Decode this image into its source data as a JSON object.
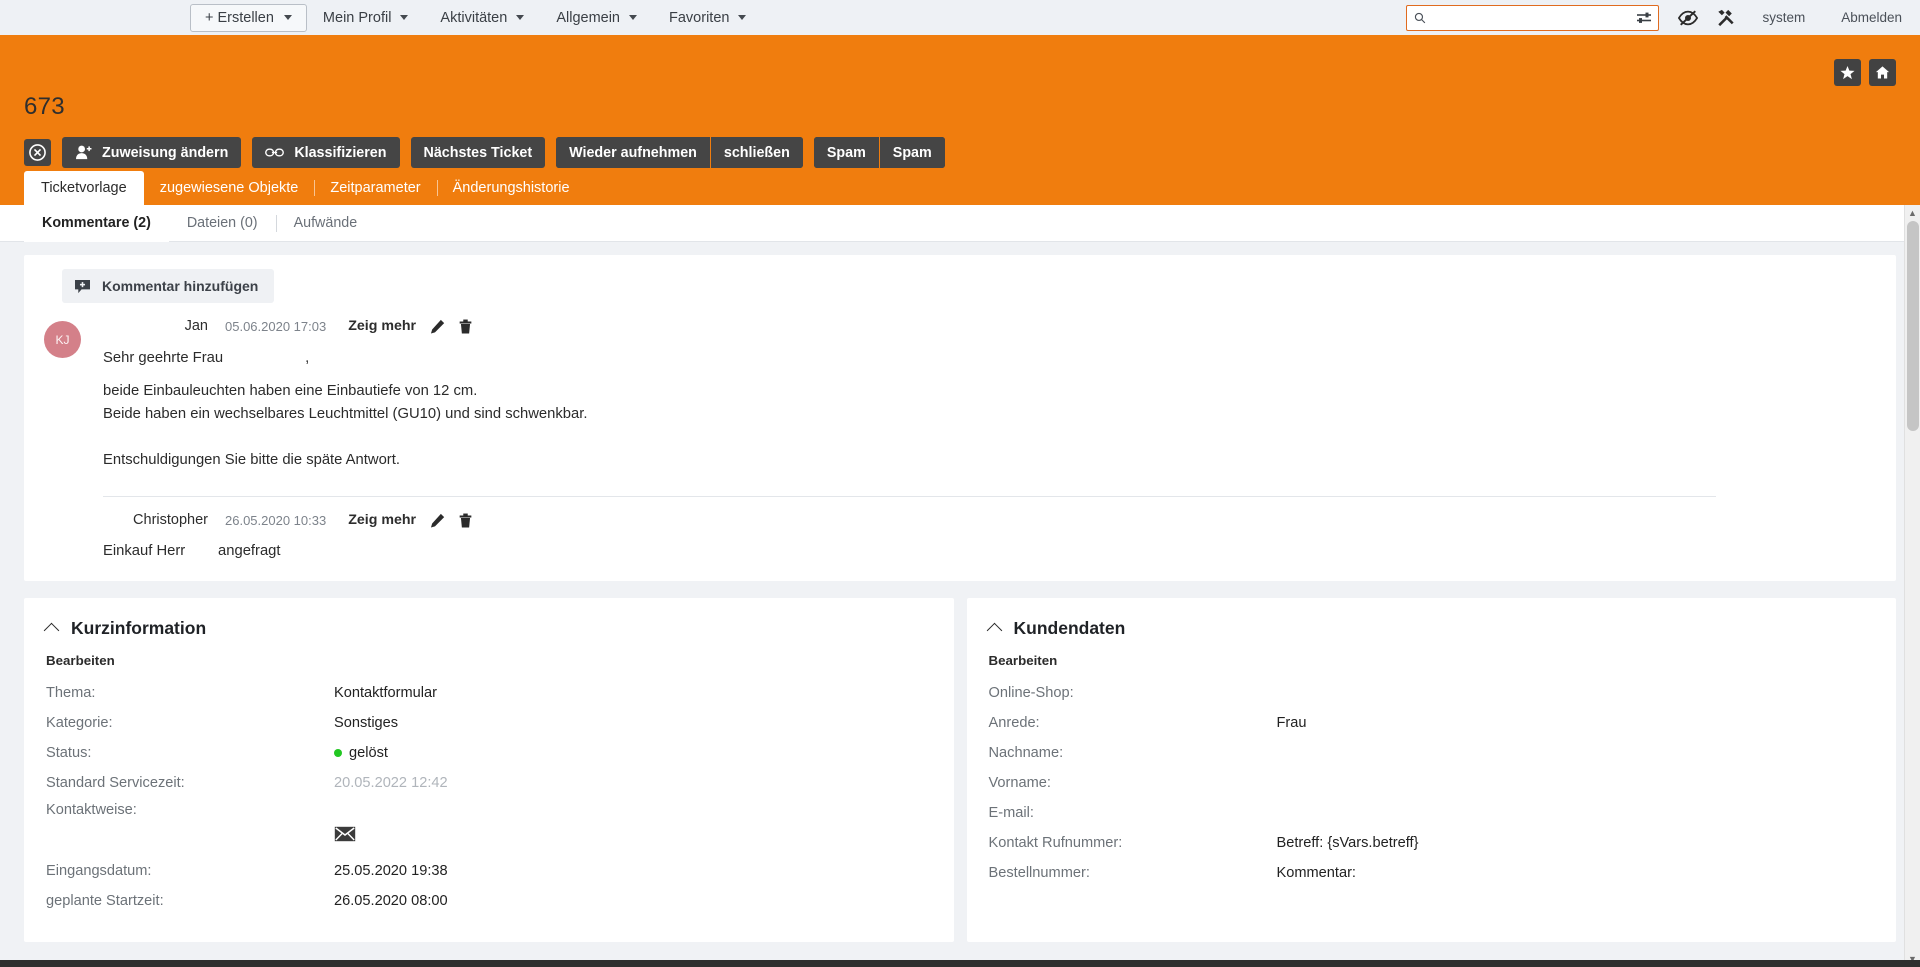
{
  "topnav": {
    "create_button": "+ Erstellen",
    "menus": [
      "Mein Profil",
      "Aktivitäten",
      "Allgemein",
      "Favoriten"
    ],
    "search": {
      "value": "",
      "placeholder": ""
    },
    "icons": [
      "filter-sliders-icon",
      "eye-slash-icon",
      "tools-icon"
    ],
    "user": "system",
    "logout": "Abmelden"
  },
  "header": {
    "ticket_number": "673",
    "accent_color": "#f07d0e",
    "close_icon": "circle-x-icon",
    "actions": [
      {
        "label": "Zuweisung ändern",
        "icon": "user-plus-icon"
      },
      {
        "label": "Klassifizieren",
        "icon": "link-chain-icon"
      },
      {
        "label": "Nächstes Ticket",
        "icon": ""
      }
    ],
    "group_a": [
      "Wieder aufnehmen",
      "schließen"
    ],
    "group_b": [
      "Spam",
      "Spam"
    ],
    "corner_icons": [
      "star-icon",
      "home-icon"
    ],
    "tabs": [
      {
        "label": "Ticketvorlage",
        "active": true
      },
      {
        "label": "zugewiesene Objekte",
        "active": false
      },
      {
        "label": "Zeitparameter",
        "active": false
      },
      {
        "label": "Änderungshistorie",
        "active": false
      }
    ]
  },
  "subtabs": [
    {
      "label": "Kommentare (2)",
      "active": true
    },
    {
      "label": "Dateien (0)",
      "active": false
    },
    {
      "label": "Aufwände",
      "active": false
    }
  ],
  "comments_panel": {
    "add_button": "Kommentar hinzufügen",
    "add_icon": "comment-plus-icon",
    "comments": [
      {
        "avatar_initials": "KJ",
        "avatar_color": "#d48089",
        "author": "Jan",
        "date": "05.06.2020 17:03",
        "show_more": "Zeig mehr",
        "edit_icon": "pencil-icon",
        "delete_icon": "trash-icon",
        "greeting": "Sehr geehrte Frau",
        "greeting_suffix": ",",
        "body": "beide Einbauleuchten haben eine Einbautiefe von 12 cm.\nBeide haben ein wechselbares Leuchtmittel (GU10) und sind schwenkbar.\n\nEntschuldigungen Sie bitte die späte Antwort."
      },
      {
        "author": "Christopher",
        "date": "26.05.2020 10:33",
        "show_more": "Zeig mehr",
        "edit_icon": "pencil-icon",
        "delete_icon": "trash-icon",
        "label": "Einkauf Herr",
        "value": "angefragt"
      }
    ]
  },
  "kurzinformation": {
    "title": "Kurzinformation",
    "edit": "Bearbeiten",
    "fields": [
      {
        "label": "Thema:",
        "value": "Kontaktformular",
        "muted": false
      },
      {
        "label": "Kategorie:",
        "value": "Sonstiges",
        "muted": false
      },
      {
        "label": "Status:",
        "value": "gelöst",
        "muted": false,
        "dot": "#22c722"
      },
      {
        "label": "Standard Servicezeit:",
        "value": "20.05.2022 12:42",
        "muted": true
      },
      {
        "label": "Kontaktweise:",
        "value": "",
        "muted": false,
        "icon": "envelope-icon"
      },
      {
        "label": "Eingangsdatum:",
        "value": "25.05.2020 19:38",
        "muted": false
      },
      {
        "label": "geplante Startzeit:",
        "value": "26.05.2020 08:00",
        "muted": false
      }
    ]
  },
  "kundendaten": {
    "title": "Kundendaten",
    "edit": "Bearbeiten",
    "fields": [
      {
        "label": "Online-Shop:",
        "value": ""
      },
      {
        "label": "Anrede:",
        "value": "Frau"
      },
      {
        "label": "Nachname:",
        "value": ""
      },
      {
        "label": "Vorname:",
        "value": ""
      },
      {
        "label": "E-mail:",
        "value": ""
      },
      {
        "label": "Kontakt Rufnummer:",
        "value": "Betreff: {sVars.betreff}"
      },
      {
        "label": "Bestellnummer:",
        "value": "Kommentar:"
      }
    ]
  }
}
